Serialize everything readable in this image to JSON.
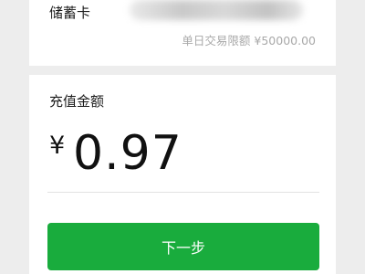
{
  "card": {
    "type_label": "储蓄卡",
    "daily_limit_text": "单日交易限额 ¥50000.00"
  },
  "recharge": {
    "amount_label": "充值金额",
    "currency_symbol": "¥",
    "amount_value": "0.97"
  },
  "actions": {
    "next_label": "下一步"
  },
  "colors": {
    "primary_button": "#19ac3d",
    "background": "#ededed",
    "secondary_text": "#a9a9a9"
  }
}
